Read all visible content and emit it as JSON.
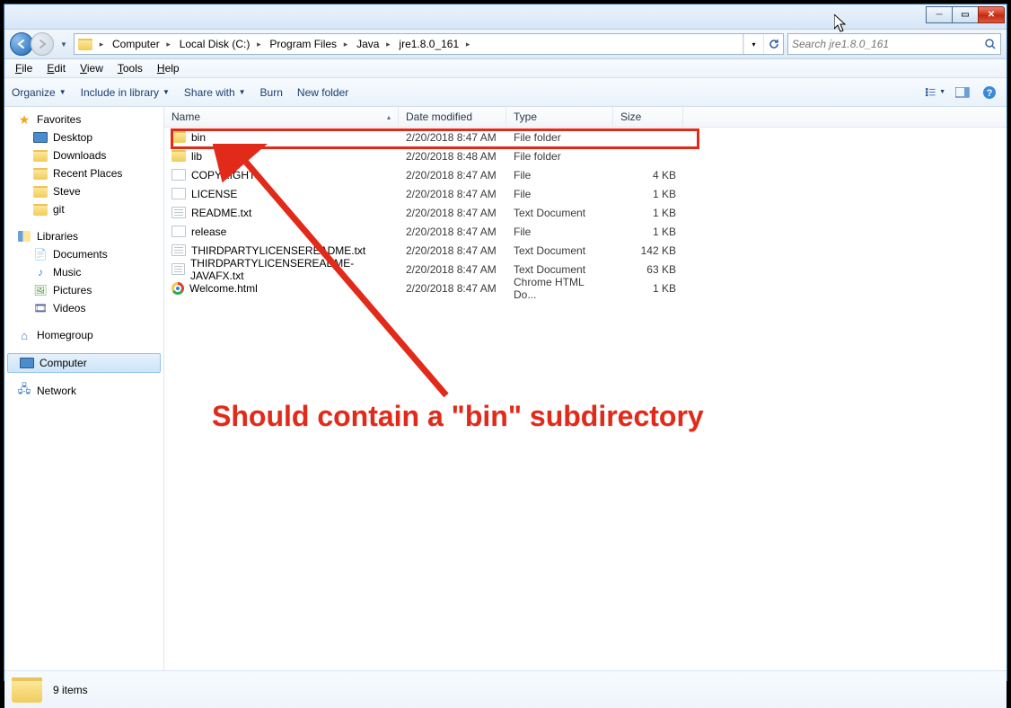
{
  "breadcrumb": [
    {
      "label": "Computer"
    },
    {
      "label": "Local Disk (C:)"
    },
    {
      "label": "Program Files"
    },
    {
      "label": "Java"
    },
    {
      "label": "jre1.8.0_161"
    }
  ],
  "search": {
    "placeholder": "Search jre1.8.0_161"
  },
  "menu": {
    "file": "File",
    "edit": "Edit",
    "view": "View",
    "tools": "Tools",
    "help": "Help"
  },
  "toolbar": {
    "organize": "Organize",
    "include": "Include in library",
    "share": "Share with",
    "burn": "Burn",
    "newfolder": "New folder"
  },
  "sidebar": {
    "favorites": {
      "header": "Favorites",
      "items": [
        {
          "label": "Desktop",
          "icon": "desktop"
        },
        {
          "label": "Downloads",
          "icon": "folder"
        },
        {
          "label": "Recent Places",
          "icon": "folder"
        },
        {
          "label": "Steve",
          "icon": "folder"
        },
        {
          "label": "git",
          "icon": "folder"
        }
      ]
    },
    "libraries": {
      "header": "Libraries",
      "items": [
        {
          "label": "Documents",
          "icon": "docs"
        },
        {
          "label": "Music",
          "icon": "music"
        },
        {
          "label": "Pictures",
          "icon": "pics"
        },
        {
          "label": "Videos",
          "icon": "vid"
        }
      ]
    },
    "homegroup": {
      "label": "Homegroup"
    },
    "computer": {
      "label": "Computer"
    },
    "network": {
      "label": "Network"
    }
  },
  "columns": {
    "name": "Name",
    "date": "Date modified",
    "type": "Type",
    "size": "Size"
  },
  "files": [
    {
      "name": "bin",
      "date": "2/20/2018 8:47 AM",
      "type": "File folder",
      "size": "",
      "icon": "folder"
    },
    {
      "name": "lib",
      "date": "2/20/2018 8:48 AM",
      "type": "File folder",
      "size": "",
      "icon": "folder"
    },
    {
      "name": "COPYRIGHT",
      "date": "2/20/2018 8:47 AM",
      "type": "File",
      "size": "4 KB",
      "icon": "file"
    },
    {
      "name": "LICENSE",
      "date": "2/20/2018 8:47 AM",
      "type": "File",
      "size": "1 KB",
      "icon": "file"
    },
    {
      "name": "README.txt",
      "date": "2/20/2018 8:47 AM",
      "type": "Text Document",
      "size": "1 KB",
      "icon": "txt"
    },
    {
      "name": "release",
      "date": "2/20/2018 8:47 AM",
      "type": "File",
      "size": "1 KB",
      "icon": "file"
    },
    {
      "name": "THIRDPARTYLICENSEREADME.txt",
      "date": "2/20/2018 8:47 AM",
      "type": "Text Document",
      "size": "142 KB",
      "icon": "txt"
    },
    {
      "name": "THIRDPARTYLICENSEREADME-JAVAFX.txt",
      "date": "2/20/2018 8:47 AM",
      "type": "Text Document",
      "size": "63 KB",
      "icon": "txt"
    },
    {
      "name": "Welcome.html",
      "date": "2/20/2018 8:47 AM",
      "type": "Chrome HTML Do...",
      "size": "1 KB",
      "icon": "chrome"
    }
  ],
  "status": {
    "count": "9 items"
  },
  "annotation": {
    "text": "Should contain a \"bin\" subdirectory"
  }
}
